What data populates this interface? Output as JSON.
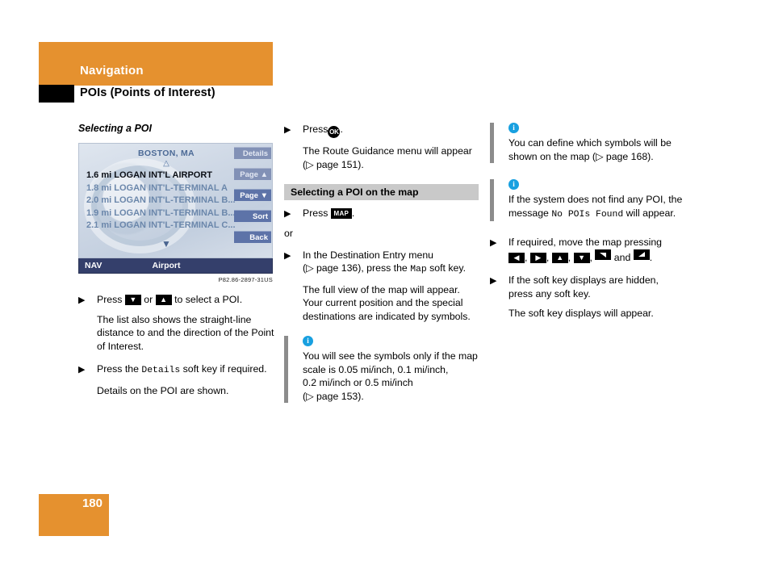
{
  "header": {
    "band_title": "Navigation",
    "subtitle": "POIs (Points of Interest)",
    "band_color": "#e5912f"
  },
  "left_column": {
    "section_title": "Selecting a POI",
    "figure": {
      "city": "BOSTON, MA",
      "up_triangle": "△",
      "down_triangle": "▼",
      "list": [
        {
          "distance": "1.6 mi",
          "name": "LOGAN INT'L AIRPORT",
          "selected": true
        },
        {
          "distance": "1.8 mi",
          "name": "LOGAN INT'L-TERMINAL A",
          "selected": false
        },
        {
          "distance": "2.0 mi",
          "name": "LOGAN INT'L-TERMINAL B...",
          "selected": false
        },
        {
          "distance": "1.9 mi",
          "name": "LOGAN INT'L-TERMINAL B...",
          "selected": false
        },
        {
          "distance": "2.1 mi",
          "name": "LOGAN INT'L-TERMINAL C...",
          "selected": false
        }
      ],
      "softkeys": [
        {
          "label": "Details",
          "dim": true
        },
        {
          "label": "Page ▲",
          "dim": true
        },
        {
          "label": "Page ▼",
          "dim": false
        },
        {
          "label": "Sort",
          "dim": false
        },
        {
          "label": "Back",
          "dim": false
        }
      ],
      "status_left": "NAV",
      "status_center": "Airport",
      "caption": "P82.86-2897-31US"
    },
    "step1_pre": "Press",
    "step1_mid": "or",
    "step1_post": "to select a POI.",
    "step1_para": "The list also shows the straight-line distance to and the direction of the Point of Interest.",
    "step2_pre": "Press the",
    "step2_key": "Details",
    "step2_post": "soft key if required.",
    "step2_para": "Details on the POI are shown."
  },
  "mid_column": {
    "step1_pre": "Press",
    "step1_key": "OK",
    "step1_post": ".",
    "step1_para_line1": "The Route Guidance menu will appear",
    "step1_para_line2": "(▷ page 151).",
    "heading": "Selecting a POI on the map",
    "step2_pre": "Press",
    "step2_key": "MAP",
    "step2_post": ".",
    "or_label": "or",
    "step3_line1": "In the Destination Entry menu",
    "step3_line2_pre": "(▷ page 136), press the",
    "step3_key": "Map",
    "step3_line2_post": "soft key.",
    "step3_para": "The full view of the map will appear. Your current position and the special destinations are indicated by symbols.",
    "note": {
      "icon": "info-icon",
      "line1": "You will see the symbols only if the map",
      "line2": "scale is 0.05 mi/inch, 0.1 mi/inch,",
      "line3": "0.2 mi/inch or 0.5 mi/inch",
      "line4": "(▷ page 153)."
    }
  },
  "right_column": {
    "note1": {
      "icon": "info-icon",
      "line1": "You can define which symbols will be",
      "line2": "shown on the map (▷ page 168)."
    },
    "note2": {
      "icon": "info-icon",
      "pre": "If the system does not find any POI, the message",
      "mono": "No POIs Found",
      "post": "will appear."
    },
    "step1_line1": "If required, move the map pressing",
    "step1_and": "and",
    "step2_line1": "If the soft key displays are hidden,",
    "step2_line2": "press any soft key.",
    "step2_para": "The soft key displays will appear."
  },
  "footer": {
    "page_number": "180",
    "box_color": "#e5912f"
  }
}
